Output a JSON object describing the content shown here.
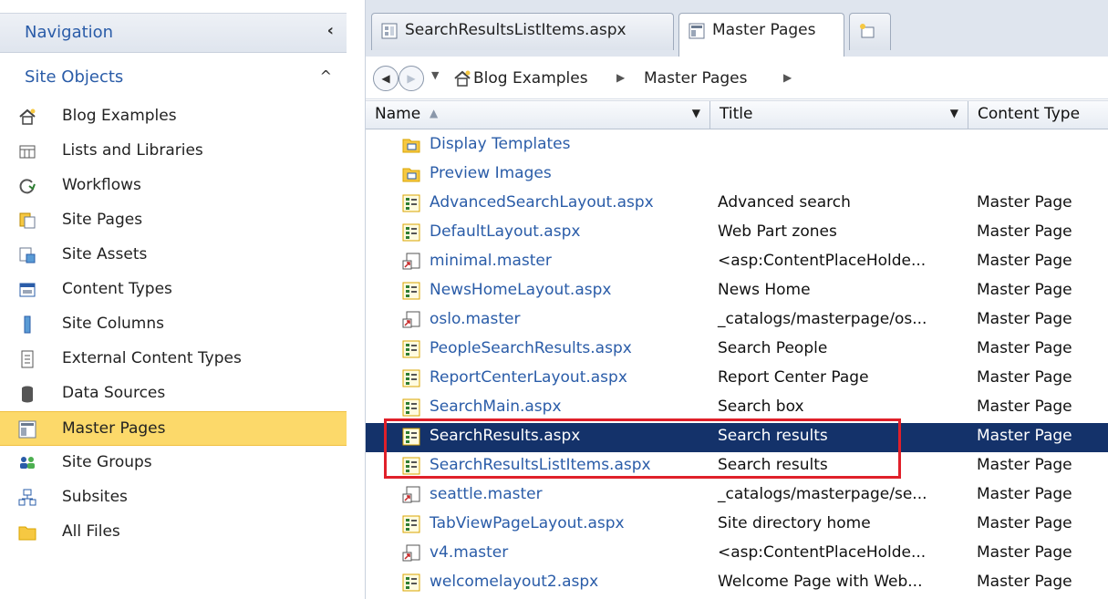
{
  "nav": {
    "title": "Navigation",
    "collapse_glyph": "‹",
    "section_title": "Site Objects",
    "section_glyph": "^",
    "items": [
      {
        "label": "Blog Examples",
        "icon": "home-icon"
      },
      {
        "label": "Lists and Libraries",
        "icon": "list-icon"
      },
      {
        "label": "Workflows",
        "icon": "workflow-icon"
      },
      {
        "label": "Site Pages",
        "icon": "pages-icon"
      },
      {
        "label": "Site Assets",
        "icon": "assets-icon"
      },
      {
        "label": "Content Types",
        "icon": "content-types-icon"
      },
      {
        "label": "Site Columns",
        "icon": "columns-icon"
      },
      {
        "label": "External Content Types",
        "icon": "external-icon"
      },
      {
        "label": "Data Sources",
        "icon": "database-icon"
      },
      {
        "label": "Master Pages",
        "icon": "master-pages-icon"
      },
      {
        "label": "Site Groups",
        "icon": "groups-icon"
      },
      {
        "label": "Subsites",
        "icon": "subsites-icon"
      },
      {
        "label": "All Files",
        "icon": "folder-icon"
      }
    ],
    "selected_index": 9
  },
  "tabs": [
    {
      "label": "SearchResultsListItems.aspx"
    },
    {
      "label": "Master Pages"
    }
  ],
  "address": {
    "back": "◀",
    "forward": "▶",
    "dropdown": "▼",
    "crumbs": [
      "Blog Examples",
      "Master Pages"
    ],
    "separator": "▶"
  },
  "columns": {
    "name": "Name",
    "name_sort": "▲",
    "dropdown": "▼",
    "title": "Title",
    "content_type": "Content Type"
  },
  "rows": [
    {
      "name": "Display Templates",
      "title": "",
      "type": "",
      "kind": "folder"
    },
    {
      "name": "Preview Images",
      "title": "",
      "type": "",
      "kind": "folder"
    },
    {
      "name": "AdvancedSearchLayout.aspx",
      "title": "Advanced search",
      "type": "Master Page",
      "kind": "layout"
    },
    {
      "name": "DefaultLayout.aspx",
      "title": "Web Part zones",
      "type": "Master Page",
      "kind": "layout"
    },
    {
      "name": "minimal.master",
      "title": "<asp:ContentPlaceHolde...",
      "type": "Master Page",
      "kind": "master"
    },
    {
      "name": "NewsHomeLayout.aspx",
      "title": "News Home",
      "type": "Master Page",
      "kind": "layout"
    },
    {
      "name": "oslo.master",
      "title": "_catalogs/masterpage/os...",
      "type": "Master Page",
      "kind": "master"
    },
    {
      "name": "PeopleSearchResults.aspx",
      "title": "Search People",
      "type": "Master Page",
      "kind": "layout"
    },
    {
      "name": "ReportCenterLayout.aspx",
      "title": "Report Center Page",
      "type": "Master Page",
      "kind": "layout"
    },
    {
      "name": "SearchMain.aspx",
      "title": "Search box",
      "type": "Master Page",
      "kind": "layout"
    },
    {
      "name": "SearchResults.aspx",
      "title": "Search results",
      "type": "Master Page",
      "kind": "layout"
    },
    {
      "name": "SearchResultsListItems.aspx",
      "title": "Search results",
      "type": "Master Page",
      "kind": "layout"
    },
    {
      "name": "seattle.master",
      "title": "_catalogs/masterpage/se...",
      "type": "Master Page",
      "kind": "master"
    },
    {
      "name": "TabViewPageLayout.aspx",
      "title": "Site directory home",
      "type": "Master Page",
      "kind": "layout"
    },
    {
      "name": "v4.master",
      "title": "<asp:ContentPlaceHolde...",
      "type": "Master Page",
      "kind": "master"
    },
    {
      "name": "welcomelayout2.aspx",
      "title": "Welcome Page with Web...",
      "type": "Master Page",
      "kind": "layout"
    }
  ],
  "selected_row": 10,
  "colors": {
    "selection": "#14326a",
    "nav_selected": "#fcd96a",
    "highlight_border": "#e0202a",
    "link": "#2a5ca8"
  }
}
